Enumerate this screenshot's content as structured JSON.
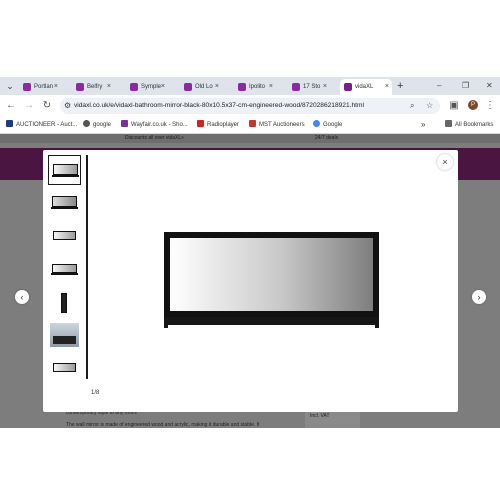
{
  "tabs": [
    {
      "label": "Portlan",
      "favicon": "tab-favicon-icon",
      "active": false
    },
    {
      "label": "Belfry",
      "favicon": "tab-favicon-icon",
      "active": false
    },
    {
      "label": "Symple",
      "favicon": "tab-favicon-icon",
      "active": false
    },
    {
      "label": "Old Lo",
      "favicon": "tab-favicon-icon",
      "active": false
    },
    {
      "label": "Ipolito",
      "favicon": "tab-favicon-icon",
      "active": false
    },
    {
      "label": "17 Sto",
      "favicon": "tab-favicon-icon",
      "active": false
    },
    {
      "label": "vidaXL",
      "favicon": "vidaxl-favicon-icon",
      "active": true
    }
  ],
  "tab_close": "×",
  "tab_add": "+",
  "window_controls": {
    "minimize": "–",
    "restore": "❐",
    "close": "✕"
  },
  "nav": {
    "back": "←",
    "forward": "→",
    "reload": "↻"
  },
  "address": {
    "url": "vidaxl.co.uk/e/vidaxl-bathroom-mirror-black-80x10.5x37-cm-engineered-wood/8720286218921.html"
  },
  "profile_initial": "P",
  "bookmarks": {
    "items": [
      {
        "label": "AUCTIONEER - Auct...",
        "icon_color": "#1a3a8a"
      },
      {
        "label": "google",
        "icon_color": "#555555"
      },
      {
        "label": "Wayfair.co.uk - Sho...",
        "icon_color": "#7b2f9e"
      },
      {
        "label": "Radioplayer",
        "icon_color": "#d42020"
      },
      {
        "label": "MST Auctioneers",
        "icon_color": "#c0392b"
      },
      {
        "label": "Google",
        "icon_color": "#4285f4"
      }
    ],
    "more": "»",
    "all_bookmarks": "All Bookmarks"
  },
  "page": {
    "promo_left": "Discounts all over vidaXL»",
    "promo_right": "24/7 deals",
    "bg_line1": "contemporary style to any room!",
    "bg_line2": "The wall mirror is made of engineered wood and acrylic, making it durable and stable. It",
    "bg_side": "Incl. VAT"
  },
  "gallery": {
    "counter": "1/8",
    "close": "×",
    "prev": "‹",
    "next": "›",
    "thumb_count": 8,
    "selected_index": 1
  },
  "colors": {
    "header_band": "#4a1541",
    "overlay": "#7d7d7d",
    "tab_favicon": "#8a2a9e"
  }
}
